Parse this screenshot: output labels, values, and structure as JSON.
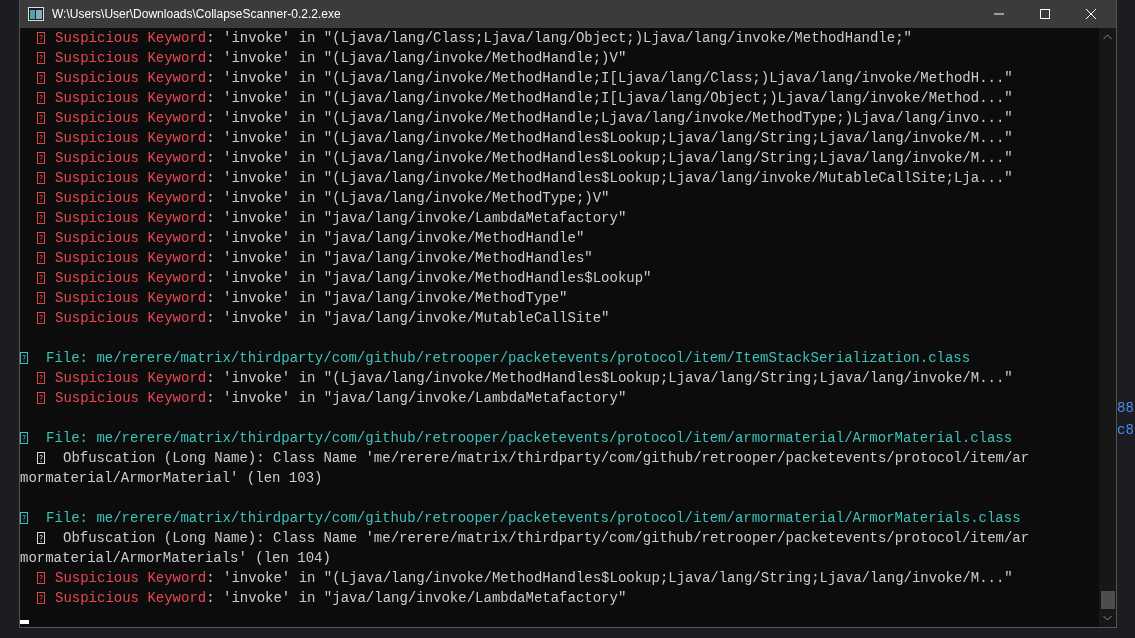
{
  "window": {
    "title": "W:\\Users\\User\\Downloads\\CollapseScanner-0.2.2.exe"
  },
  "console": {
    "lines": [
      {
        "kind": "keyword",
        "label": "Suspicious Keyword",
        "text": ": 'invoke' in \"(Ljava/lang/Class;Ljava/lang/Object;)Ljava/lang/invoke/MethodHandle;\""
      },
      {
        "kind": "keyword",
        "label": "Suspicious Keyword",
        "text": ": 'invoke' in \"(Ljava/lang/invoke/MethodHandle;)V\""
      },
      {
        "kind": "keyword",
        "label": "Suspicious Keyword",
        "text": ": 'invoke' in \"(Ljava/lang/invoke/MethodHandle;I[Ljava/lang/Class;)Ljava/lang/invoke/MethodH...\""
      },
      {
        "kind": "keyword",
        "label": "Suspicious Keyword",
        "text": ": 'invoke' in \"(Ljava/lang/invoke/MethodHandle;I[Ljava/lang/Object;)Ljava/lang/invoke/Method...\""
      },
      {
        "kind": "keyword",
        "label": "Suspicious Keyword",
        "text": ": 'invoke' in \"(Ljava/lang/invoke/MethodHandle;Ljava/lang/invoke/MethodType;)Ljava/lang/invo...\""
      },
      {
        "kind": "keyword",
        "label": "Suspicious Keyword",
        "text": ": 'invoke' in \"(Ljava/lang/invoke/MethodHandles$Lookup;Ljava/lang/String;Ljava/lang/invoke/M...\""
      },
      {
        "kind": "keyword",
        "label": "Suspicious Keyword",
        "text": ": 'invoke' in \"(Ljava/lang/invoke/MethodHandles$Lookup;Ljava/lang/String;Ljava/lang/invoke/M...\""
      },
      {
        "kind": "keyword",
        "label": "Suspicious Keyword",
        "text": ": 'invoke' in \"(Ljava/lang/invoke/MethodHandles$Lookup;Ljava/lang/invoke/MutableCallSite;Lja...\""
      },
      {
        "kind": "keyword",
        "label": "Suspicious Keyword",
        "text": ": 'invoke' in \"(Ljava/lang/invoke/MethodType;)V\""
      },
      {
        "kind": "keyword",
        "label": "Suspicious Keyword",
        "text": ": 'invoke' in \"java/lang/invoke/LambdaMetafactory\""
      },
      {
        "kind": "keyword",
        "label": "Suspicious Keyword",
        "text": ": 'invoke' in \"java/lang/invoke/MethodHandle\""
      },
      {
        "kind": "keyword",
        "label": "Suspicious Keyword",
        "text": ": 'invoke' in \"java/lang/invoke/MethodHandles\""
      },
      {
        "kind": "keyword",
        "label": "Suspicious Keyword",
        "text": ": 'invoke' in \"java/lang/invoke/MethodHandles$Lookup\""
      },
      {
        "kind": "keyword",
        "label": "Suspicious Keyword",
        "text": ": 'invoke' in \"java/lang/invoke/MethodType\""
      },
      {
        "kind": "keyword",
        "label": "Suspicious Keyword",
        "text": ": 'invoke' in \"java/lang/invoke/MutableCallSite\""
      },
      {
        "kind": "blank"
      },
      {
        "kind": "file",
        "text": "File: me/rerere/matrix/thirdparty/com/github/retrooper/packetevents/protocol/item/ItemStackSerialization.class"
      },
      {
        "kind": "keyword",
        "label": "Suspicious Keyword",
        "text": ": 'invoke' in \"(Ljava/lang/invoke/MethodHandles$Lookup;Ljava/lang/String;Ljava/lang/invoke/M...\""
      },
      {
        "kind": "keyword",
        "label": "Suspicious Keyword",
        "text": ": 'invoke' in \"java/lang/invoke/LambdaMetafactory\""
      },
      {
        "kind": "blank"
      },
      {
        "kind": "file",
        "text": "File: me/rerere/matrix/thirdparty/com/github/retrooper/packetevents/protocol/item/armormaterial/ArmorMaterial.class"
      },
      {
        "kind": "obfuscation",
        "text": "Obfuscation (Long Name): Class Name 'me/rerere/matrix/thirdparty/com/github/retrooper/packetevents/protocol/item/ar",
        "continuation": "mormaterial/ArmorMaterial' (len 103)"
      },
      {
        "kind": "blank"
      },
      {
        "kind": "file",
        "text": "File: me/rerere/matrix/thirdparty/com/github/retrooper/packetevents/protocol/item/armormaterial/ArmorMaterials.class"
      },
      {
        "kind": "obfuscation",
        "text": "Obfuscation (Long Name): Class Name 'me/rerere/matrix/thirdparty/com/github/retrooper/packetevents/protocol/item/ar",
        "continuation": "mormaterial/ArmorMaterials' (len 104)"
      },
      {
        "kind": "keyword",
        "label": "Suspicious Keyword",
        "text": ": 'invoke' in \"(Ljava/lang/invoke/MethodHandles$Lookup;Ljava/lang/String;Ljava/lang/invoke/M...\""
      },
      {
        "kind": "keyword",
        "label": "Suspicious Keyword",
        "text": ": 'invoke' in \"java/lang/invoke/LambdaMetafactory\""
      }
    ]
  },
  "background_texts": [
    "88",
    "c8"
  ]
}
